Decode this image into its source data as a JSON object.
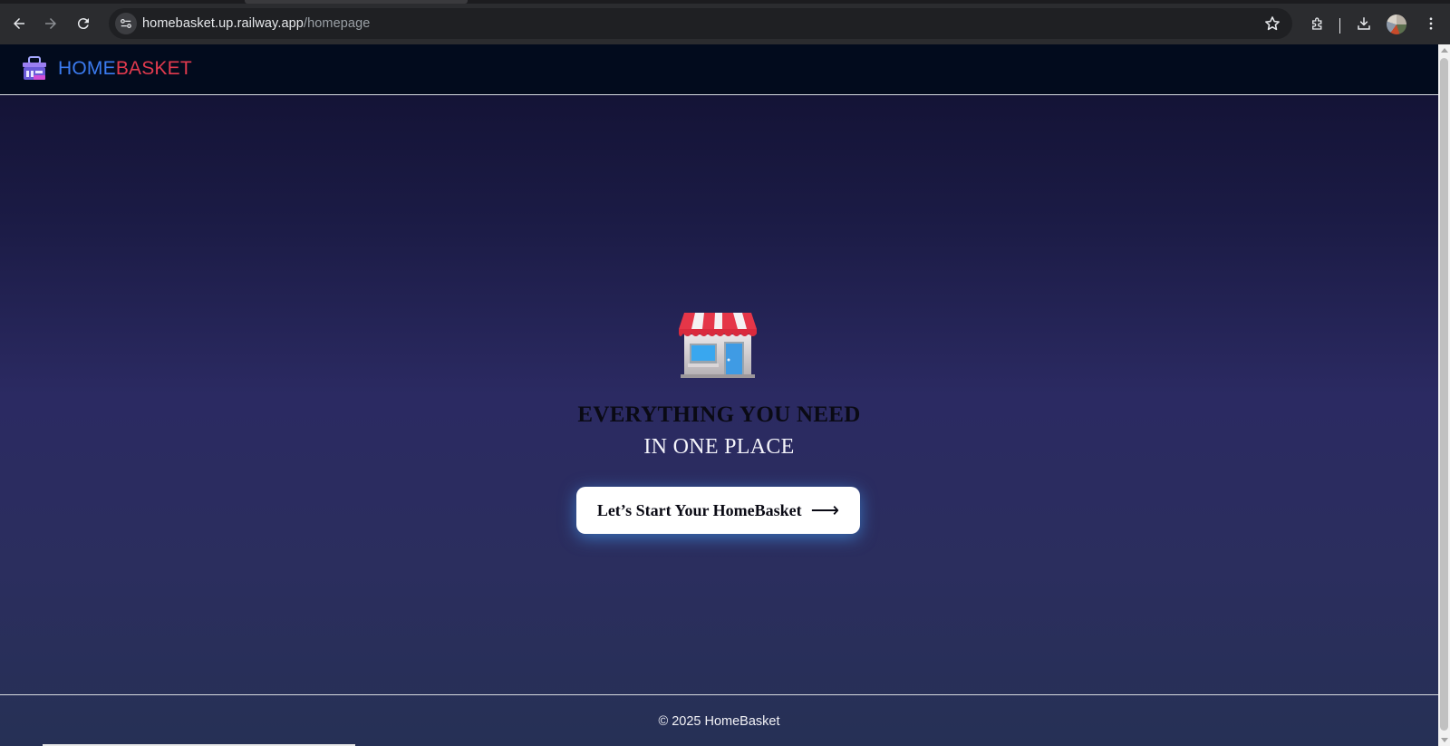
{
  "browser": {
    "url_host": "homebasket.up.railway.app",
    "url_path": "/homepage",
    "icons": [
      "back-arrow-icon",
      "forward-arrow-icon",
      "reload-icon",
      "site-info-icon",
      "bookmark-star-icon",
      "extensions-icon",
      "download-icon",
      "profile-avatar",
      "menu-dots-icon"
    ]
  },
  "header": {
    "logo_home": "HOME",
    "logo_basket": "BASKET",
    "logo_icon": "basket-icon"
  },
  "hero": {
    "icon": "store-icon",
    "headline_line1": "EVERYTHING YOU NEED",
    "headline_line2": "IN ONE PLACE",
    "cta_label": "Let’s Start Your HomeBasket",
    "cta_arrow": "⟶"
  },
  "footer": {
    "text": "© 2025 HomeBasket"
  },
  "colors": {
    "brand_blue": "#3b7bf0",
    "brand_red": "#e23a4e",
    "header_bg": "#020b1d",
    "cta_glow": "#4296eb"
  }
}
